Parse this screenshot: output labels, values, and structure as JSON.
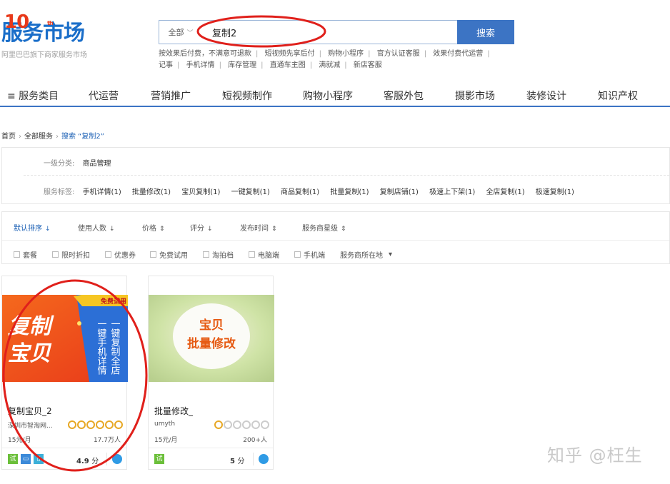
{
  "logo": {
    "mark": "服务市场",
    "ten": "10",
    "th": "th",
    "subtitle": "阿里巴巴旗下商家服务市场"
  },
  "search": {
    "scope": "全部",
    "value": "复制2",
    "button": "搜索"
  },
  "hotlinks": {
    "row1": [
      "按效果后付费，不满意可退款",
      "短视频先享后付",
      "购物小程序",
      "官方认证客服",
      "效果付费代运营"
    ],
    "row2": [
      "记事",
      "手机详情",
      "库存管理",
      "直通车主图",
      "满就减",
      "新店客服"
    ]
  },
  "nav": {
    "items": [
      "≡ 服务类目",
      "代运营",
      "营销推广",
      "短视频制作",
      "购物小程序",
      "客服外包",
      "摄影市场",
      "装修设计",
      "知识产权"
    ]
  },
  "breadcrumb": {
    "home": "首页",
    "all": "全部服务",
    "current": "搜索 “复制2”"
  },
  "filters": {
    "category_label": "一级分类:",
    "category_value": "商品管理",
    "tags_label": "服务标签:",
    "tags": [
      "手机详情(1)",
      "批量修改(1)",
      "宝贝复制(1)",
      "一键复制(1)",
      "商品复制(1)",
      "批量复制(1)",
      "复制店铺(1)",
      "极速上下架(1)",
      "全店复制(1)",
      "极速复制(1)"
    ]
  },
  "sort": {
    "items": [
      {
        "label": "默认排序",
        "icon": "↓"
      },
      {
        "label": "使用人数",
        "icon": "↓"
      },
      {
        "label": "价格",
        "icon": "⇕"
      },
      {
        "label": "评分",
        "icon": "↓"
      },
      {
        "label": "发布时间",
        "icon": "⇕"
      },
      {
        "label": "服务商星级",
        "icon": "⇕"
      }
    ],
    "checks": [
      "套餐",
      "限时折扣",
      "优惠券",
      "免费试用",
      "淘拍档",
      "电脑端",
      "手机端"
    ],
    "location": "服务商所在地",
    "location_icon": "▾"
  },
  "products": [
    {
      "name": "复制宝贝_2",
      "shop": "深圳市智淘网...",
      "gold_medals": 6,
      "price": "15元/月",
      "users": "17.7万人",
      "score": "4.9",
      "score_unit": "分",
      "badges": [
        "试",
        "电脑端",
        "手机端"
      ],
      "thumb": {
        "big_text_1": "复制",
        "big_text_2": "宝贝",
        "col_1": "一键手机详情",
        "col_2": "一键复制全店",
        "ribbon": "免费试用"
      }
    },
    {
      "name": "批量修改_",
      "shop": "umyth",
      "gold_medals": 1,
      "price": "15元/月",
      "users": "200+人",
      "score": "5",
      "score_unit": "分",
      "badges": [
        "试"
      ],
      "thumb": {
        "line_1": "宝贝",
        "line_2": "批量修改"
      }
    }
  ],
  "watermark": "知乎 @枉生",
  "colors": {
    "brand_blue": "#3c74c4",
    "annotation_red": "#e0201b",
    "active_link": "#1a5fb4"
  }
}
